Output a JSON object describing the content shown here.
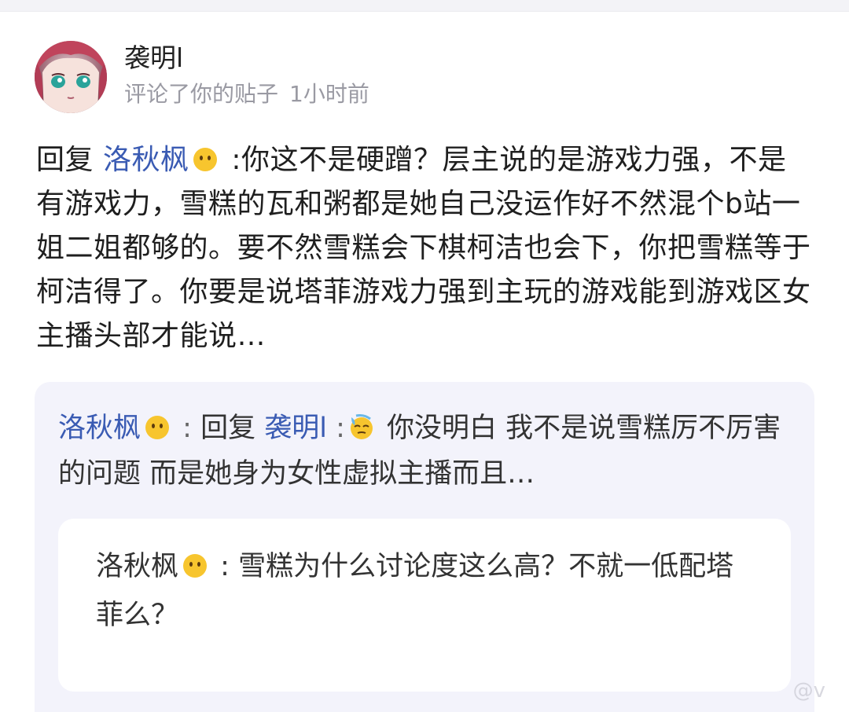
{
  "header": {
    "username": "袭明l",
    "action": "评论了你的贴子",
    "time": "1小时前"
  },
  "comment": {
    "prefix": "回复",
    "mention": "洛秋枫",
    "emoji_icon": "neutral-face-icon",
    "text": " :你这不是硬蹭？层主说的是游戏力强，不是有游戏力，雪糕的瓦和粥都是她自己没运作好不然混个b站一姐二姐都够的。要不然雪糕会下棋柯洁也会下，你把雪糕等于柯洁得了。你要是说塔菲游戏力强到主玩的游戏能到游戏区女主播头部才能说…"
  },
  "reply": {
    "author": "洛秋枫",
    "author_emoji": "neutral-face-icon",
    "separator": " : ",
    "prefix": "回复",
    "mention": "袭明l",
    "mention_emoji": "sweat-face-icon",
    "text": "你没明白 我不是说雪糕厉不厉害的问题 而是她身为女性虚拟主播而且…"
  },
  "nested": {
    "author": "洛秋枫",
    "author_emoji": "neutral-face-icon",
    "separator": " : ",
    "text": "雪糕为什么讨论度这么高？不就一低配塔菲么？"
  },
  "watermark": "@v",
  "colors": {
    "link": "#3a5bb3",
    "meta": "#9a9aa3",
    "reply_bg": "#f3f3fb"
  }
}
